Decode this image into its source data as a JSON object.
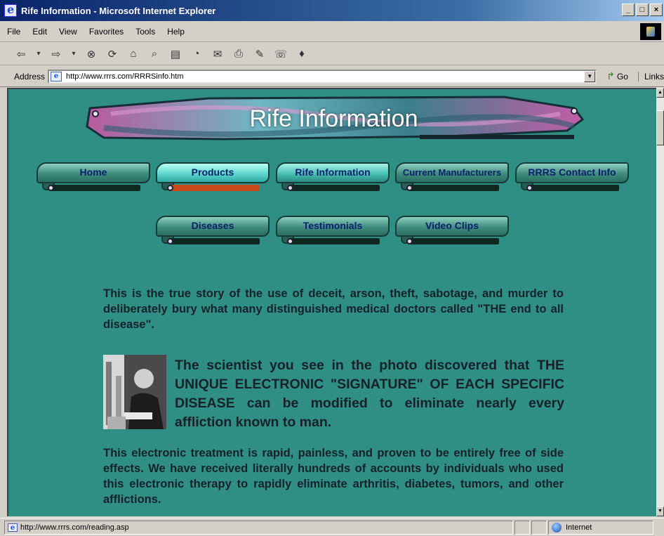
{
  "window": {
    "title": "Rife Information - Microsoft Internet Explorer",
    "buttons": [
      "_",
      "□",
      "×"
    ]
  },
  "menu": [
    "File",
    "Edit",
    "View",
    "Favorites",
    "Tools",
    "Help"
  ],
  "toolbar": [
    "back-icon",
    "forward-icon",
    "stop-icon",
    "refresh-icon",
    "home-icon",
    "search-icon",
    "favorites-icon",
    "history-icon",
    "mail-icon",
    "print-icon",
    "edit-icon",
    "discuss-icon",
    "messenger-icon"
  ],
  "address": {
    "label": "Address",
    "url": "http://www.rrrs.com/RRRSinfo.htm",
    "go": "Go",
    "links": "Links"
  },
  "banner": {
    "title": "Rife Information"
  },
  "nav": {
    "row1": [
      {
        "label": "Home"
      },
      {
        "label": "Products",
        "active": true
      },
      {
        "label": "Rife Information"
      },
      {
        "label": "Current Manufacturers"
      },
      {
        "label": "RRRS Contact Info"
      }
    ],
    "row2": [
      {
        "label": "Diseases"
      },
      {
        "label": "Testimonials"
      },
      {
        "label": "Video Clips"
      }
    ]
  },
  "content": {
    "intro": "This is the true story of the use of deceit, arson, theft, sabotage, and murder to deliberately bury what many distinguished medical doctors called \"THE end to all disease\".",
    "highlight": "The scientist you see in the photo discovered that THE UNIQUE ELECTRONIC \"SIGNATURE\" OF EACH SPECIFIC DISEASE can be modified to eliminate nearly every affliction known to man.",
    "body": "This electronic treatment is rapid, painless, and proven to be entirely free of side effects. We have received literally hundreds of accounts by individuals who used this electronic therapy to rapidly eliminate arthritis, diabetes, tumors, and other afflictions."
  },
  "status": {
    "url": "http://www.rrrs.com/reading.asp",
    "zone": "Internet"
  }
}
